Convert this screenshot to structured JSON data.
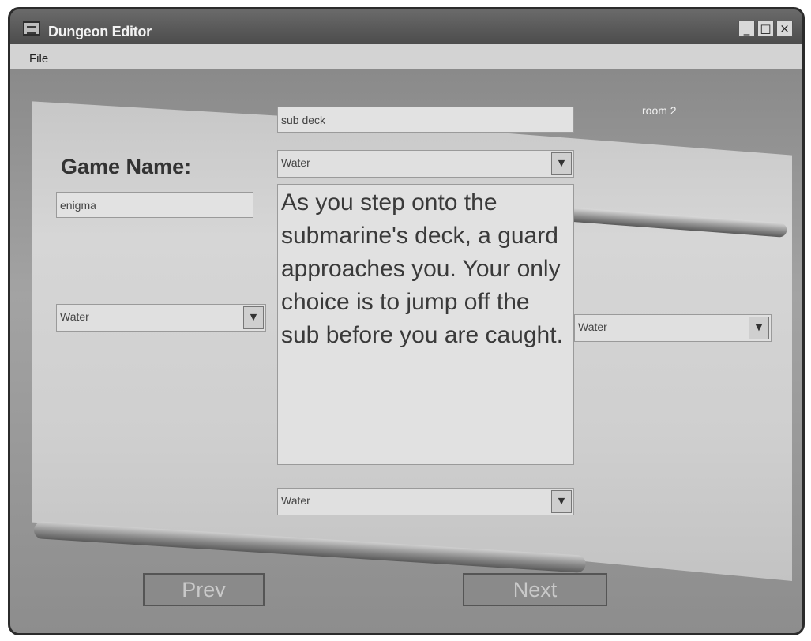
{
  "window": {
    "title": "Dungeon Editor",
    "minimize_glyph": "_",
    "maximize_glyph": "□",
    "close_glyph": "×"
  },
  "menu": {
    "file": "File"
  },
  "room": {
    "label": "room 2"
  },
  "game": {
    "name_label": "Game Name:",
    "name_value": "enigma"
  },
  "room_name": {
    "value": "sub deck"
  },
  "exits": {
    "north": "Water",
    "west": "Water",
    "east": "Water",
    "south": "Water"
  },
  "description": {
    "text": "As you step onto the submarine's deck, a guard approaches you. Your only choice is to jump off the sub before you are caught."
  },
  "buttons": {
    "prev": "Prev",
    "next": "Next"
  },
  "icons": {
    "dropdown": "chevron-down-icon",
    "app": "app-icon"
  },
  "colors": {
    "titlebar": "#5a5a5a",
    "parchment": "#d0d0d0",
    "background": "#8d8d8d"
  }
}
